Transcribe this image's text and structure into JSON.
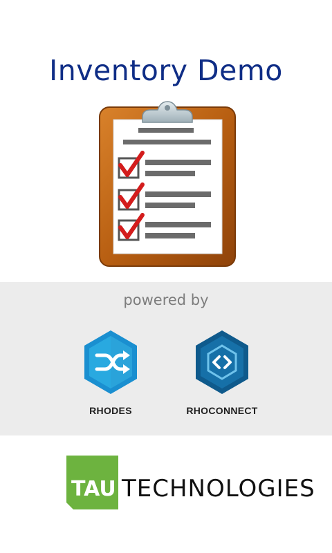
{
  "app": {
    "title": "Inventory Demo"
  },
  "hero": {
    "icon": "clipboard-checklist-icon",
    "checked_items": 3
  },
  "powered": {
    "label": "powered by",
    "products": [
      {
        "name": "RHODES",
        "icon": "shuffle-icon",
        "color": "#29a9e0"
      },
      {
        "name": "RHOCONNECT",
        "icon": "code-sync-icon",
        "color": "#1670a8"
      }
    ]
  },
  "company": {
    "logo_text": "TAU",
    "name": "TECHNOLOGIES",
    "brand_color": "#6db33f"
  }
}
